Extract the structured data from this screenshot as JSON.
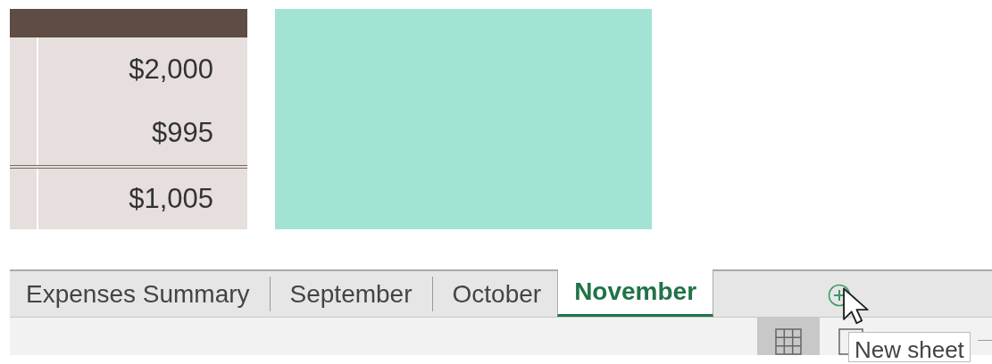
{
  "table": {
    "rows": [
      {
        "kind": "value",
        "amount": "$2,000"
      },
      {
        "kind": "value",
        "amount": "$995"
      },
      {
        "kind": "total",
        "amount": "$1,005"
      }
    ]
  },
  "shape": {
    "kind": "rectangle"
  },
  "sheet_tabs": [
    {
      "label": "Expenses Summary",
      "selected": false
    },
    {
      "label": "September",
      "selected": false
    },
    {
      "label": "October",
      "selected": false
    },
    {
      "label": "November",
      "selected": true
    }
  ],
  "status_bar": {
    "views": [
      {
        "kind": "normal",
        "selected": true
      },
      {
        "kind": "page_layout",
        "selected": false
      }
    ]
  },
  "tooltip": {
    "text": "New sheet"
  }
}
